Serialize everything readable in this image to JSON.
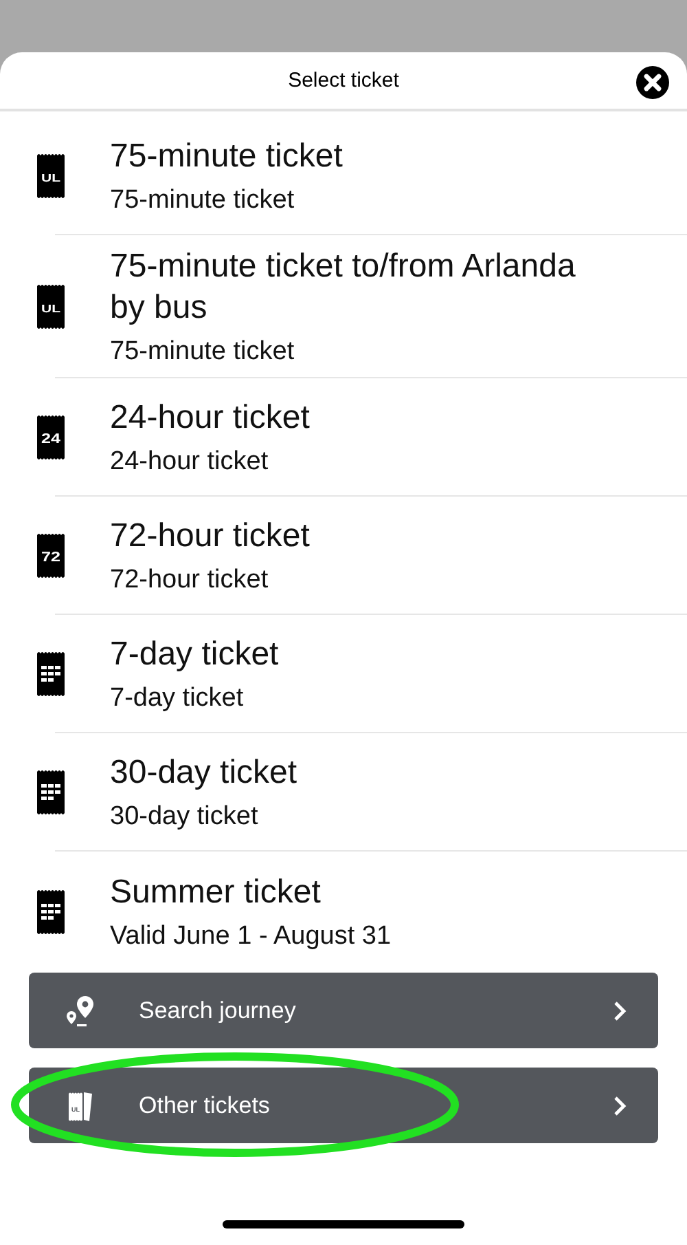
{
  "sheet": {
    "title": "Select ticket"
  },
  "tickets": [
    {
      "title": "75-minute ticket",
      "subtitle": "75-minute ticket",
      "icon": {
        "kind": "text",
        "label": "UL"
      }
    },
    {
      "title": "75-minute ticket to/from Arlanda by bus",
      "subtitle": "75-minute ticket",
      "icon": {
        "kind": "text",
        "label": "UL"
      }
    },
    {
      "title": "24-hour ticket",
      "subtitle": "24-hour ticket",
      "icon": {
        "kind": "text",
        "label": "24"
      }
    },
    {
      "title": "72-hour ticket",
      "subtitle": "72-hour ticket",
      "icon": {
        "kind": "text",
        "label": "72"
      }
    },
    {
      "title": "7-day ticket",
      "subtitle": "7-day ticket",
      "icon": {
        "kind": "grid"
      }
    },
    {
      "title": "30-day ticket",
      "subtitle": "30-day ticket",
      "icon": {
        "kind": "grid"
      }
    },
    {
      "title": "Summer ticket",
      "subtitle": "Valid June 1 - August 31",
      "icon": {
        "kind": "grid"
      }
    }
  ],
  "actions": [
    {
      "label": "Search journey",
      "icon": {
        "kind": "pins"
      },
      "highlight": false
    },
    {
      "label": "Other tickets",
      "icon": {
        "kind": "tickets",
        "label": "UL"
      },
      "highlight": true
    }
  ]
}
